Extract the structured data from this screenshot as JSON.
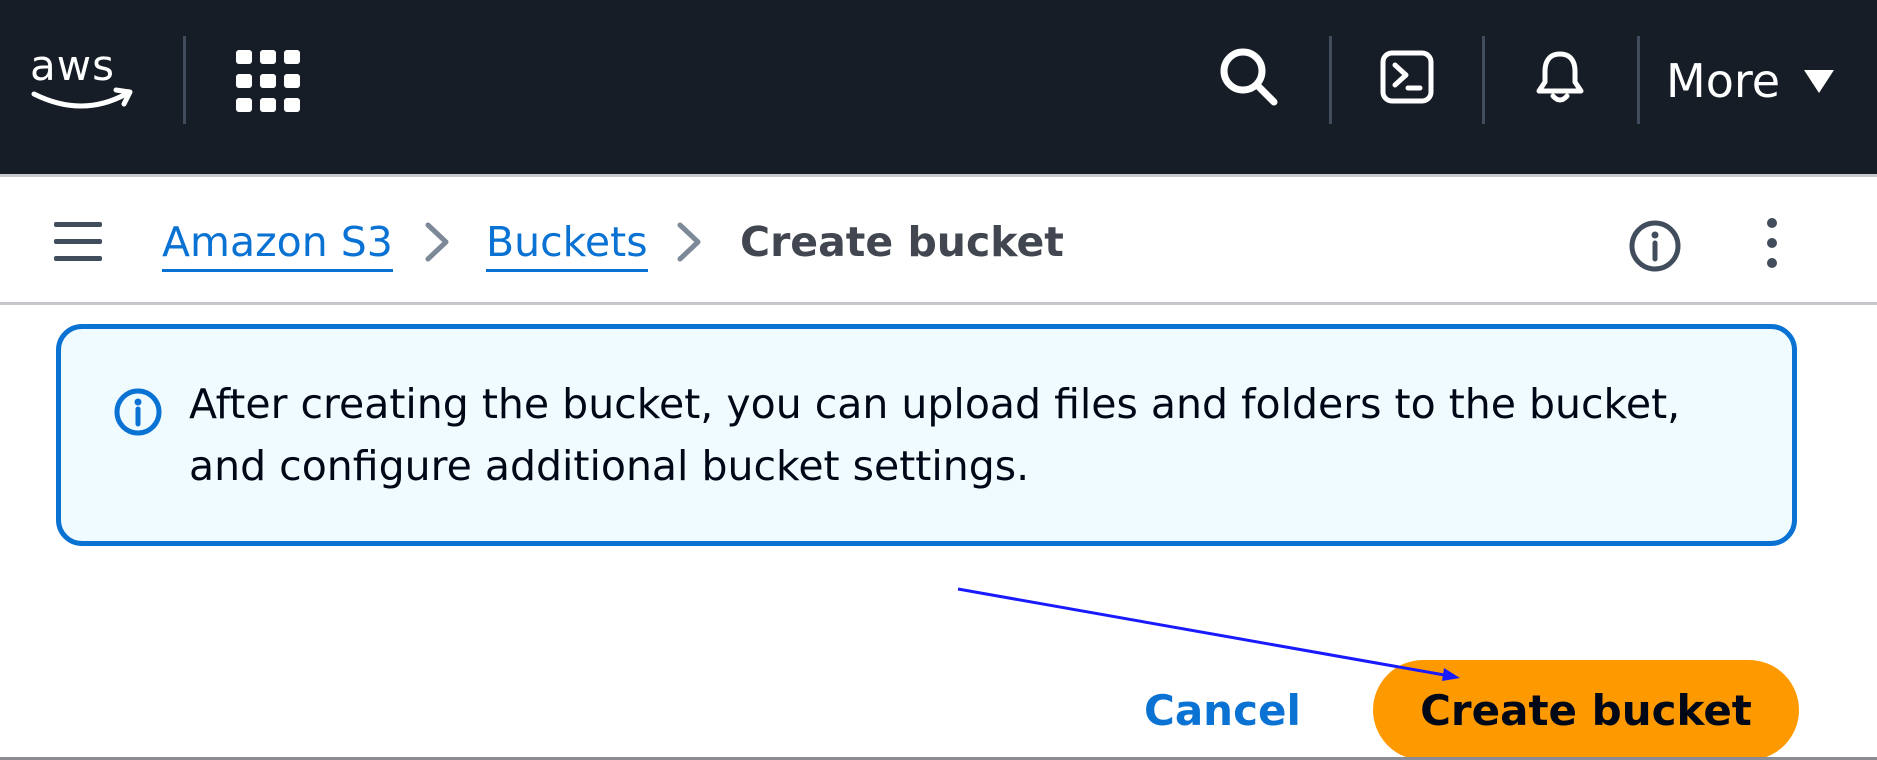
{
  "nav": {
    "logo_text": "aws",
    "more_label": "More",
    "icons": [
      "apps-grid-icon",
      "search-icon",
      "cloudshell-icon",
      "notifications-bell-icon",
      "caret-down-icon"
    ]
  },
  "breadcrumb": {
    "items": [
      {
        "label": "Amazon S3",
        "link": true
      },
      {
        "label": "Buckets",
        "link": true
      },
      {
        "label": "Create bucket",
        "link": false
      }
    ]
  },
  "alert": {
    "icon": "info-icon",
    "text": "After creating the bucket, you can upload files and folders to the bucket, and configure additional bucket settings."
  },
  "actions": {
    "cancel_label": "Cancel",
    "create_label": "Create bucket"
  },
  "colors": {
    "nav_bg": "#161d26",
    "link": "#0972d3",
    "primary_button": "#ff9900",
    "alert_bg": "#f0fbff",
    "annotation_arrow": "#1a1aff"
  }
}
